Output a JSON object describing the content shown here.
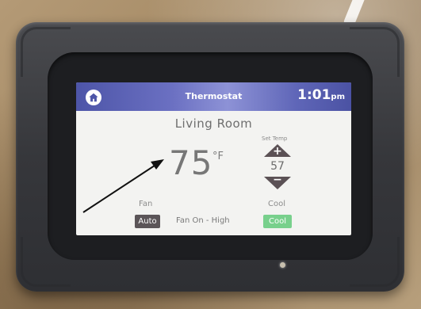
{
  "titlebar": {
    "title": "Thermostat",
    "time": "1:01",
    "ampm": "pm"
  },
  "room": "Living Room",
  "current_temp": {
    "value": "75",
    "unit": "°F"
  },
  "set_temp": {
    "label": "Set Temp",
    "value": "57",
    "increase_symbol": "+",
    "decrease_symbol": "−"
  },
  "fan": {
    "label": "Fan",
    "mode_button": "Auto",
    "status": "Fan On - High"
  },
  "mode": {
    "label": "Cool",
    "button": "Cool"
  },
  "colors": {
    "titlebar": "#5f66b8",
    "cool_button": "#78d08c",
    "auto_button": "#5b5558"
  },
  "icons": {
    "home": "home-icon",
    "annotation": "arrow-annotation"
  }
}
